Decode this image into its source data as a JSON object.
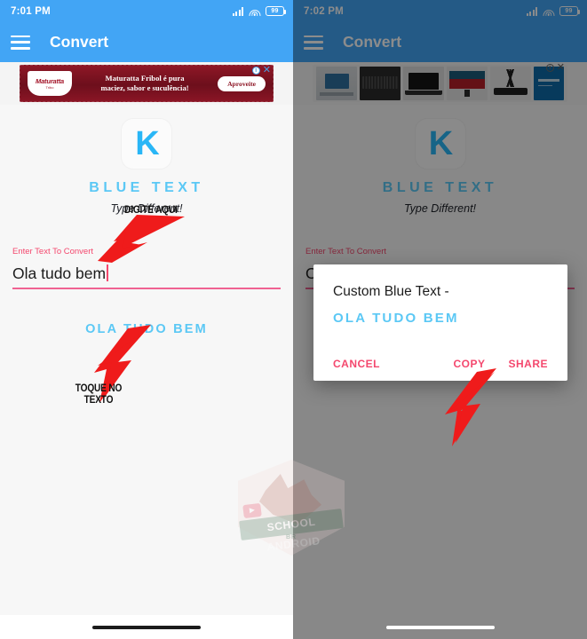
{
  "left": {
    "status": {
      "time": "7:01 PM",
      "battery": "99",
      "signal_icon": "signal-bars-icon",
      "wifi_icon": "wifi-icon",
      "battery_icon": "battery-icon"
    },
    "appbar": {
      "menu_icon": "hamburger-menu-icon",
      "title": "Convert"
    },
    "ad": {
      "logo_text": "Maturatta",
      "logo_sub": "Tribo",
      "headline_line1": "Maturatta Fribol é pura",
      "headline_line2": "maciez, sabor e suculência!",
      "cta": "Aproveite",
      "info_icon": "ad-info-icon",
      "close_icon": "ad-close-icon"
    },
    "brand": {
      "logo_letter": "K",
      "name": "BLUE TEXT",
      "tagline": "Type Different!"
    },
    "field": {
      "label": "Enter Text To Convert",
      "value": "Ola tudo bem",
      "placeholder": "Enter Text To Convert"
    },
    "output": {
      "text": "OLA TUDO BEM"
    },
    "annotations": {
      "type_here": "DIGITE AQUI",
      "tap_text_line1": "TOQUE NO",
      "tap_text_line2": "TEXTO"
    }
  },
  "right": {
    "status": {
      "time": "7:02 PM",
      "battery": "99"
    },
    "appbar": {
      "title": "Convert"
    },
    "ad": {
      "info_icon": "ad-info-icon",
      "close_icon": "ad-close-icon"
    },
    "brand": {
      "logo_letter": "K",
      "name": "BLUE TEXT",
      "tagline": "Type Different!"
    },
    "field": {
      "label": "Enter Text To Convert",
      "value": "Ola tudo bem"
    },
    "dialog": {
      "title": "Custom Blue Text -",
      "text": "OLA TUDO BEM",
      "cancel": "CANCEL",
      "copy": "COPY",
      "share": "SHARE"
    }
  },
  "watermark": {
    "title": "SCHOOL ANDROID",
    "subtitle": "BR"
  },
  "colors": {
    "appbar_blue": "#42a5f5",
    "brand_blue": "#5bc8f5",
    "accent_pink": "#f4486e",
    "arrow_red": "#ef1b1b",
    "dialog_bg": "#ffffff",
    "scrim": "rgba(0,0,0,0.45)"
  }
}
